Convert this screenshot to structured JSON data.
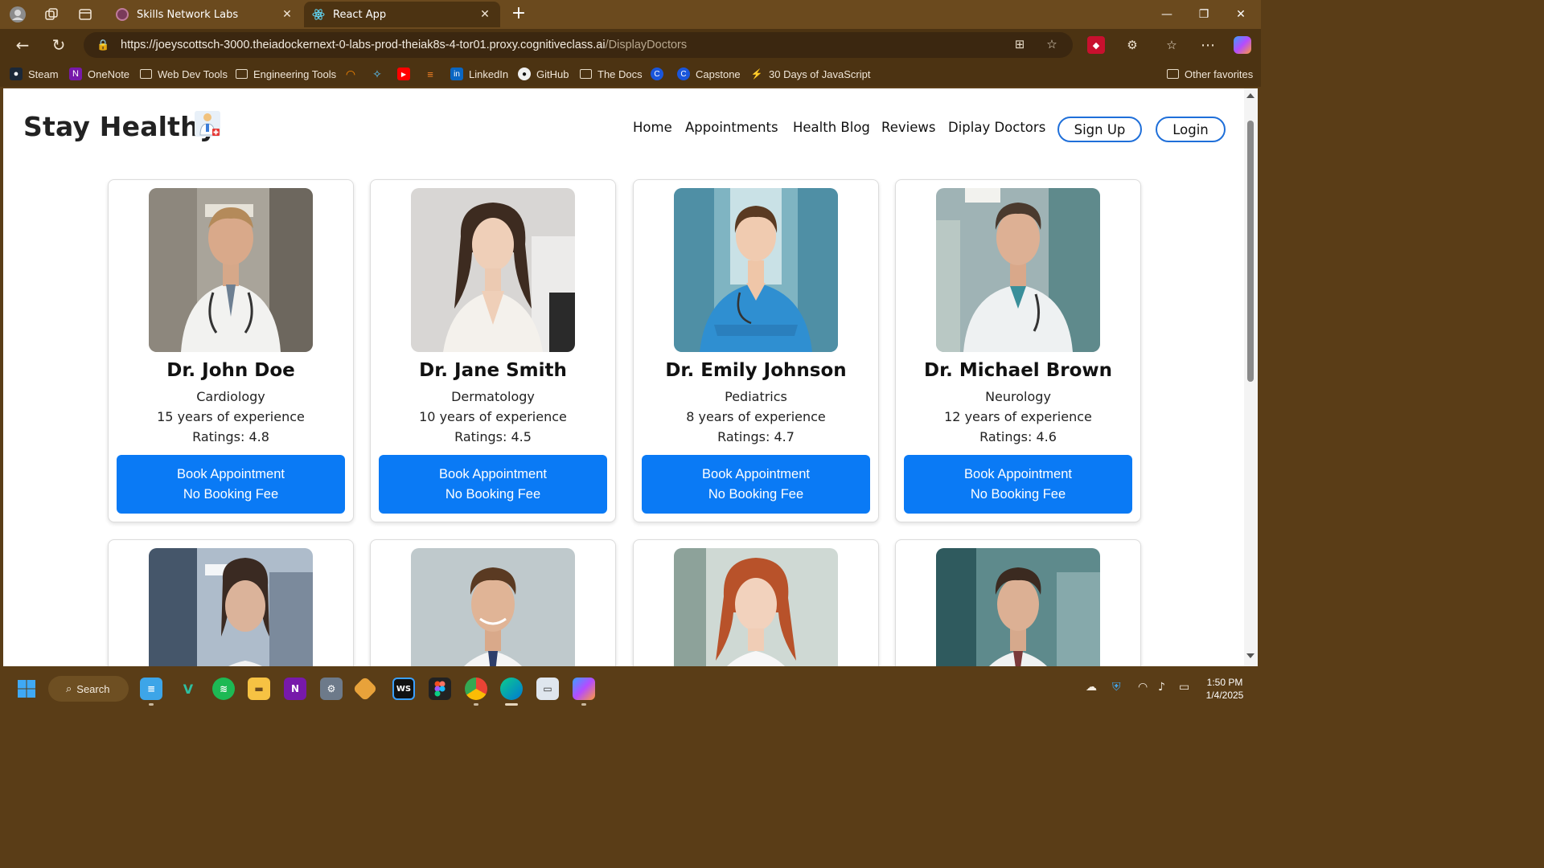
{
  "browser": {
    "tabs": [
      {
        "title": "Skills Network Labs",
        "active": false
      },
      {
        "title": "React App",
        "active": true
      }
    ],
    "url_host": "https://joeyscottsch-3000.theiadockernext-0-labs-prod-theiak8s-4-tor01.proxy.cognitiveclass.ai",
    "url_path": "/DisplayDoctors",
    "bookmarks": [
      "Steam",
      "OneNote",
      "Web Dev Tools",
      "Engineering Tools",
      "LinkedIn",
      "GitHub",
      "The Docs",
      "Capstone",
      "30 Days of JavaScript",
      "Other favorites"
    ]
  },
  "site": {
    "logo": "Stay Healthy",
    "nav": [
      "Home",
      "Appointments",
      "Health Blog",
      "Reviews",
      "Diplay Doctors"
    ],
    "signup": "Sign Up",
    "login": "Login",
    "book_line1": "Book Appointment",
    "book_line2": "No Booking Fee"
  },
  "doctors": [
    {
      "name": "Dr. John Doe",
      "specialty": "Cardiology",
      "experience": "15 years of experience",
      "ratings": "Ratings: 4.8"
    },
    {
      "name": "Dr. Jane Smith",
      "specialty": "Dermatology",
      "experience": "10 years of experience",
      "ratings": "Ratings: 4.5"
    },
    {
      "name": "Dr. Emily Johnson",
      "specialty": "Pediatrics",
      "experience": "8 years of experience",
      "ratings": "Ratings: 4.7"
    },
    {
      "name": "Dr. Michael Brown",
      "specialty": "Neurology",
      "experience": "12 years of experience",
      "ratings": "Ratings: 4.6"
    }
  ],
  "taskbar": {
    "search_label": "Search",
    "time": "1:50 PM",
    "date": "1/4/2025"
  },
  "colors": {
    "accent": "#0a7af5",
    "nav_border": "#1f6fd9",
    "chrome": "#4c3312",
    "taskbar": "#5a3d17"
  }
}
